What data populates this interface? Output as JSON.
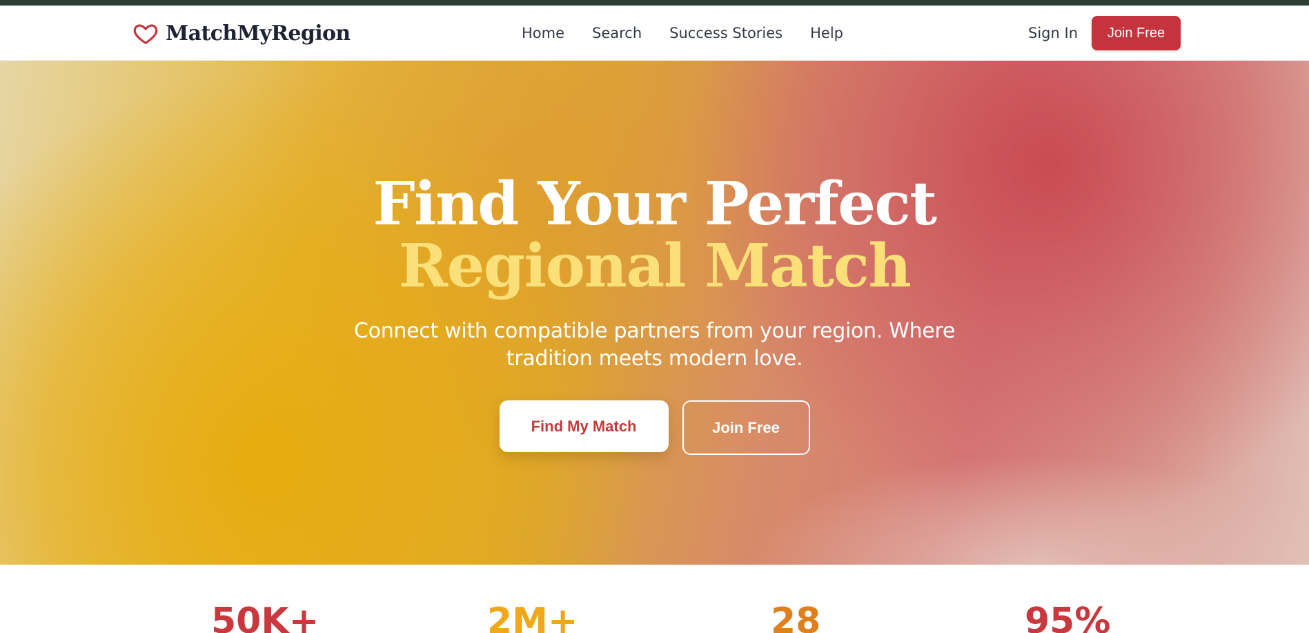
{
  "brand": {
    "name": "MatchMyRegion",
    "icon": "heart-icon",
    "color": "#c5333c"
  },
  "nav": {
    "links": [
      {
        "label": "Home"
      },
      {
        "label": "Search"
      },
      {
        "label": "Success Stories"
      },
      {
        "label": "Help"
      }
    ],
    "sign_in": "Sign In",
    "join": "Join Free"
  },
  "hero": {
    "title_line1": "Find Your Perfect",
    "title_line2": "Regional Match",
    "subtitle_line1": "Connect with compatible partners from your region. Where",
    "subtitle_line2": "tradition meets modern love.",
    "primary_cta": "Find My Match",
    "secondary_cta": "Join Free"
  },
  "stats": [
    {
      "value": "50K+"
    },
    {
      "value": "2M+"
    },
    {
      "value": "28"
    },
    {
      "value": "95%"
    }
  ],
  "colors": {
    "accent": "#c5333c",
    "gold": "#fbe07a",
    "top_bar": "#2f3d33"
  }
}
